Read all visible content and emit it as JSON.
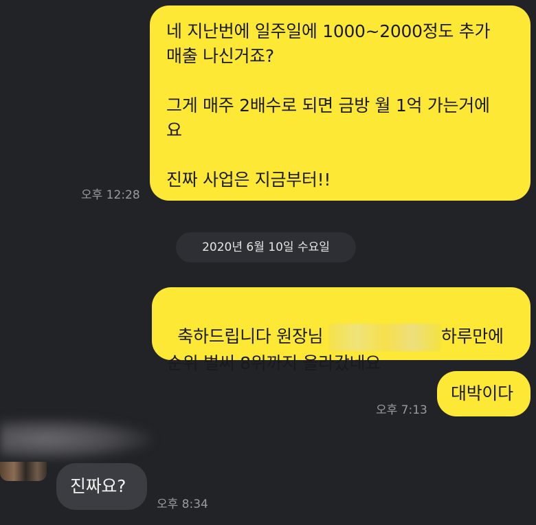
{
  "messages": [
    {
      "text": "네 지난번에 일주일에 1000~2000정도 추가\n매출 나신거죠?\n\n그게 매주 2배수로 되면 금방 월 1억 가는거에\n요\n\n진짜 사업은 지금부터!!",
      "time": "오후 12:28"
    },
    {
      "part1": "축하드립니다 원장님 ",
      "part2": "하루만에\n순위 벌써 8위까지 올라갔네요"
    },
    {
      "text": "대박이다",
      "time": "오후 7:13"
    },
    {
      "text": "진짜요?",
      "time": "오후 8:34"
    }
  ],
  "date_divider": "2020년 6월 10일 수요일",
  "colors": {
    "background": "#222327",
    "outgoing_bubble": "#fce835",
    "incoming_bubble": "#3c3d42"
  }
}
